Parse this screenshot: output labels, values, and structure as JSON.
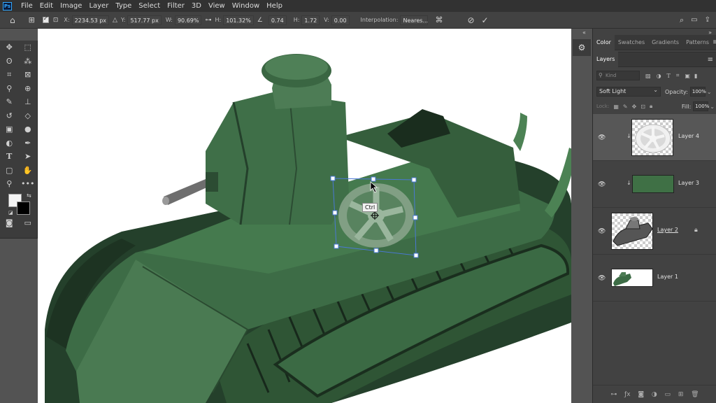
{
  "app": {
    "logo": "Ps"
  },
  "menu": [
    "File",
    "Edit",
    "Image",
    "Layer",
    "Type",
    "Select",
    "Filter",
    "3D",
    "View",
    "Window",
    "Help"
  ],
  "options": {
    "x_label": "X:",
    "x_value": "2234.53 px",
    "y_label": "Y:",
    "y_value": "517.77 px",
    "w_label": "W:",
    "w_value": "90.69%",
    "h_label": "H:",
    "h_value": "101.32%",
    "angle_value": "0.74",
    "hskew_label": "H:",
    "hskew_value": "1.72",
    "vskew_label": "V:",
    "vskew_value": "0.00",
    "interp_label": "Interpolation:",
    "interp_value": "Neares..."
  },
  "canvas": {
    "tooltip": "Ctrl"
  },
  "top_tabs": [
    "Color",
    "Swatches",
    "Gradients",
    "Patterns"
  ],
  "layers_panel": {
    "title": "Layers",
    "filter_placeholder": "Kind",
    "blend_mode": "Soft Light",
    "opacity_label": "Opacity:",
    "opacity_value": "100%",
    "lock_label": "Lock:",
    "fill_label": "Fill:",
    "fill_value": "100%",
    "layers": [
      {
        "name": "Layer 4",
        "selected": true,
        "clipped": true
      },
      {
        "name": "Layer 3",
        "selected": false,
        "clipped": true
      },
      {
        "name": "Layer 2",
        "selected": false,
        "locked": true
      },
      {
        "name": "Layer 1",
        "selected": false
      }
    ]
  },
  "colors": {
    "tank_green": "#3d6c46",
    "tank_dark": "#1f3a25",
    "panel_bg": "#424242",
    "selection": "#4a78d6"
  }
}
